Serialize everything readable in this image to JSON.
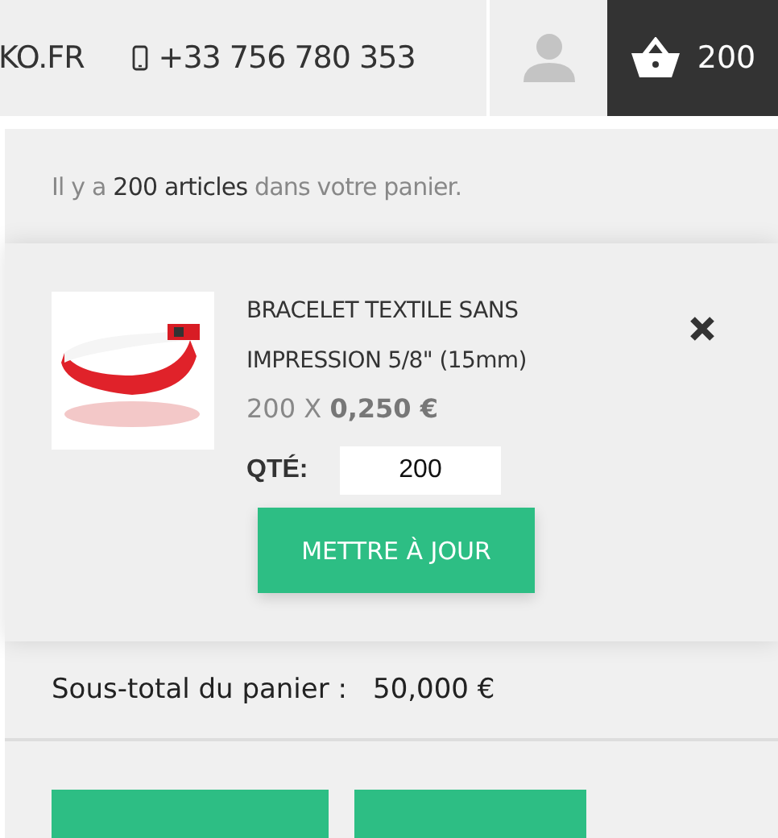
{
  "header": {
    "site": "KO.FR",
    "phone": "+33 756 780 353",
    "cart_count": "200"
  },
  "cart": {
    "summary": "Il y a **200 articles** dans votre panier.",
    "item": {
      "name": "BRACELET TEXTILE SANS IMPRESSION 5/8\" (15mm)",
      "quantity_price": "200 X",
      "unit_price": "0,250 €",
      "qty_label": "QTÉ:",
      "qty_value": "200",
      "update_button": "METTRE À JOUR"
    },
    "subtotal_label": "Sous-total du panier :",
    "subtotal_value": "50,000 €"
  }
}
